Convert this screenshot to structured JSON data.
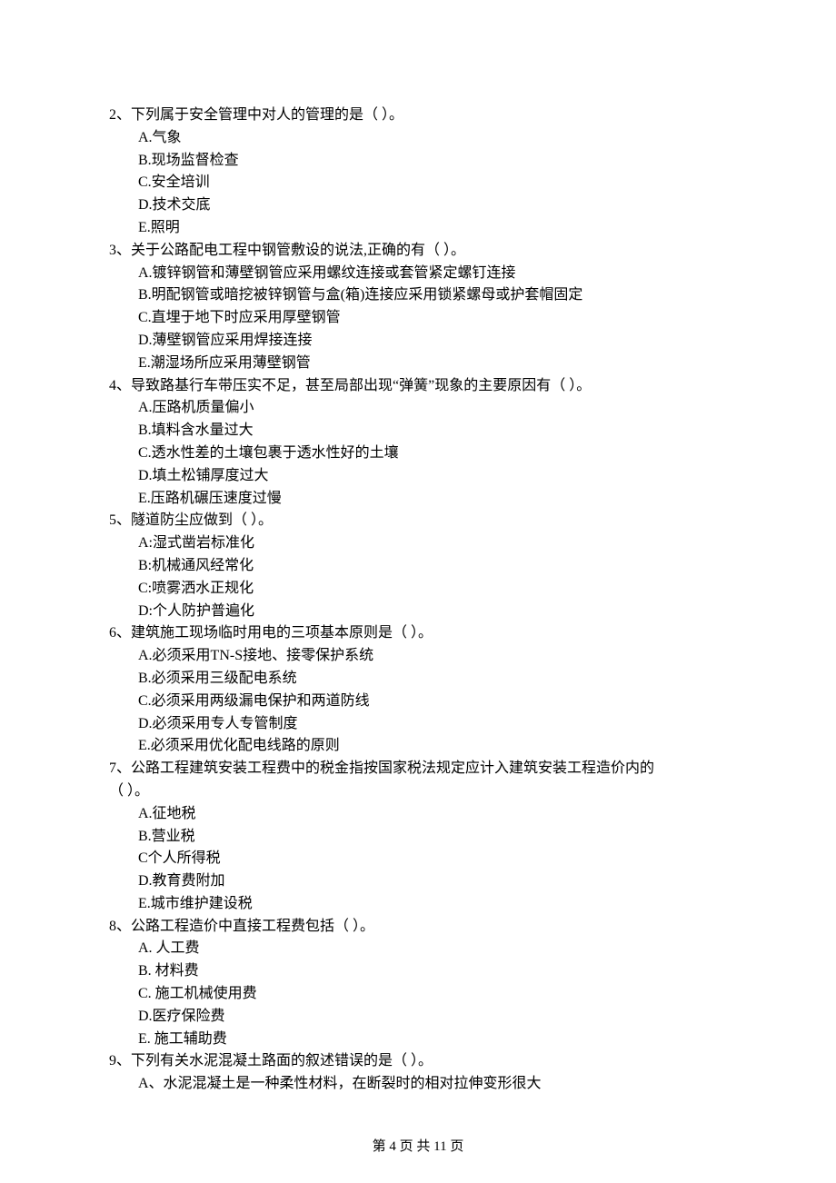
{
  "questions": [
    {
      "number": "2、",
      "stem": "下列属于安全管理中对人的管理的是（    ）。",
      "options": [
        "A.气象",
        "B.现场监督检查",
        "C.安全培训",
        "D.技术交底",
        "E.照明"
      ]
    },
    {
      "number": "3、",
      "stem": "关于公路配电工程中钢管敷设的说法,正确的有（    ）。",
      "options": [
        "A.镀锌钢管和薄壁钢管应采用螺纹连接或套管紧定螺钉连接",
        "B.明配钢管或暗挖被锌钢管与盒(箱)连接应采用锁紧螺母或护套帽固定",
        "C.直埋于地下时应采用厚壁钢管",
        "D.薄壁钢管应采用焊接连接",
        "E.潮湿场所应采用薄壁钢管"
      ]
    },
    {
      "number": "4、",
      "stem": "导致路基行车带压实不足，甚至局部出现“弹簧”现象的主要原因有（    ）。",
      "options": [
        "A.压路机质量偏小",
        "B.填料含水量过大",
        "C.透水性差的土壤包裹于透水性好的土壤",
        "D.填土松铺厚度过大",
        "E.压路机碾压速度过慢"
      ]
    },
    {
      "number": "5、",
      "stem": "隧道防尘应做到（    ）。",
      "options": [
        "A:湿式凿岩标准化",
        "B:机械通风经常化",
        "C:喷雾洒水正规化",
        "D:个人防护普遍化"
      ]
    },
    {
      "number": "6、",
      "stem": "建筑施工现场临时用电的三项基本原则是（    ）。",
      "options": [
        "A.必须采用TN-S接地、接零保护系统",
        "B.必须采用三级配电系统",
        "C.必须采用两级漏电保护和两道防线",
        "D.必须采用专人专管制度",
        "E.必须采用优化配电线路的原则"
      ]
    },
    {
      "number": "7、",
      "stem": "公路工程建筑安装工程费中的税金指按国家税法规定应计入建筑安装工程造价内的",
      "stem_cont": "（    ）。",
      "options": [
        "A.征地税",
        "B.营业税",
        "C个人所得税",
        "D.教育费附加",
        "E.城市维护建设税"
      ]
    },
    {
      "number": "8、",
      "stem": "公路工程造价中直接工程费包括（    ）。",
      "options": [
        "A.  人工费",
        "B.  材料费",
        "C.  施工机械使用费",
        "D.医疗保险费",
        "E.  施工辅助费"
      ]
    },
    {
      "number": "9、",
      "stem": "下列有关水泥混凝土路面的叙述错误的是（    ）。",
      "options": [
        "A、水泥混凝土是一种柔性材料，在断裂时的相对拉伸变形很大"
      ]
    }
  ],
  "footer": {
    "prefix": "第 ",
    "page": "4",
    "middle": " 页 共 ",
    "total": "11",
    "suffix": " 页"
  }
}
